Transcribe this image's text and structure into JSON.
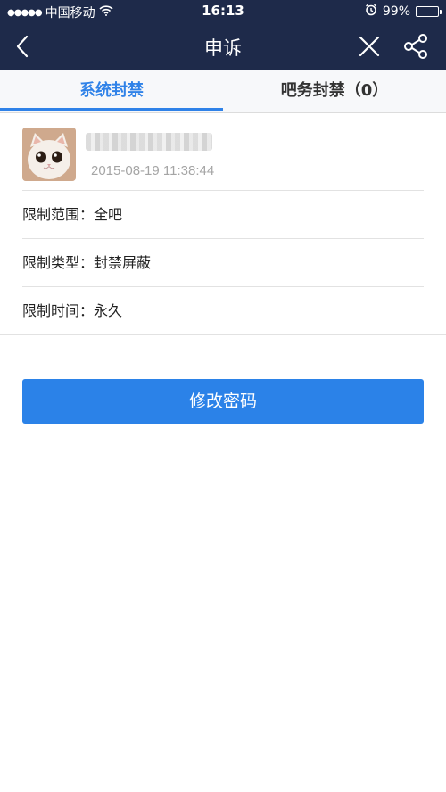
{
  "status_bar": {
    "carrier": "中国移动",
    "time": "16:13",
    "battery": "99%",
    "battery_level": 0.99
  },
  "nav": {
    "title": "申诉"
  },
  "tabs": [
    {
      "label": "系统封禁",
      "active": true
    },
    {
      "label": "吧务封禁（0）",
      "active": false
    }
  ],
  "user": {
    "timestamp": "2015-08-19 11:38:44"
  },
  "restrictions": [
    {
      "label": "限制范围：",
      "value": "全吧"
    },
    {
      "label": "限制类型：",
      "value": "封禁屏蔽"
    },
    {
      "label": "限制时间：",
      "value": "永久"
    }
  ],
  "action": {
    "button_label": "修改密码"
  },
  "colors": {
    "nav_bg": "#1e2a4a",
    "accent": "#2f82e8"
  }
}
